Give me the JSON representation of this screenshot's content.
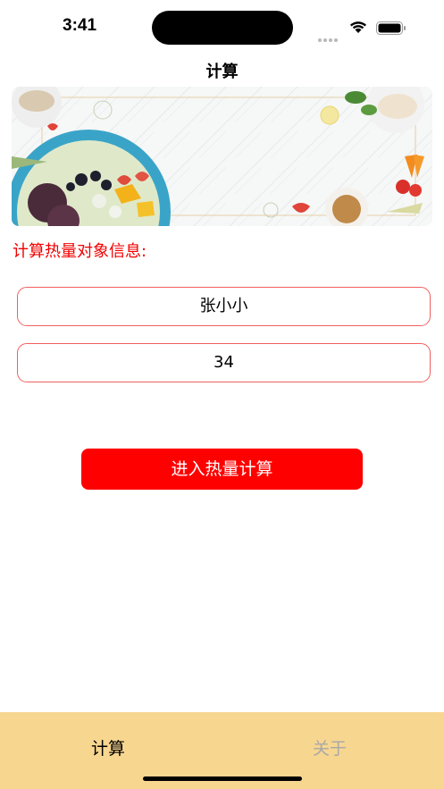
{
  "status_bar": {
    "time": "3:41"
  },
  "nav": {
    "title": "计算"
  },
  "banner": {
    "description_icon": "food-banner-image"
  },
  "form": {
    "section_label": "计算热量对象信息:",
    "name_value": "张小小",
    "age_value": "34"
  },
  "actions": {
    "enter_label": "进入热量计算"
  },
  "tabs": [
    {
      "label": "计算",
      "active": true
    },
    {
      "label": "关于",
      "active": false
    }
  ],
  "colors": {
    "accent": "#ff0000",
    "section_label": "#f20000",
    "field_border": "#f06060",
    "tab_bar": "#f7d690",
    "tab_inactive": "#a8a8a8"
  }
}
